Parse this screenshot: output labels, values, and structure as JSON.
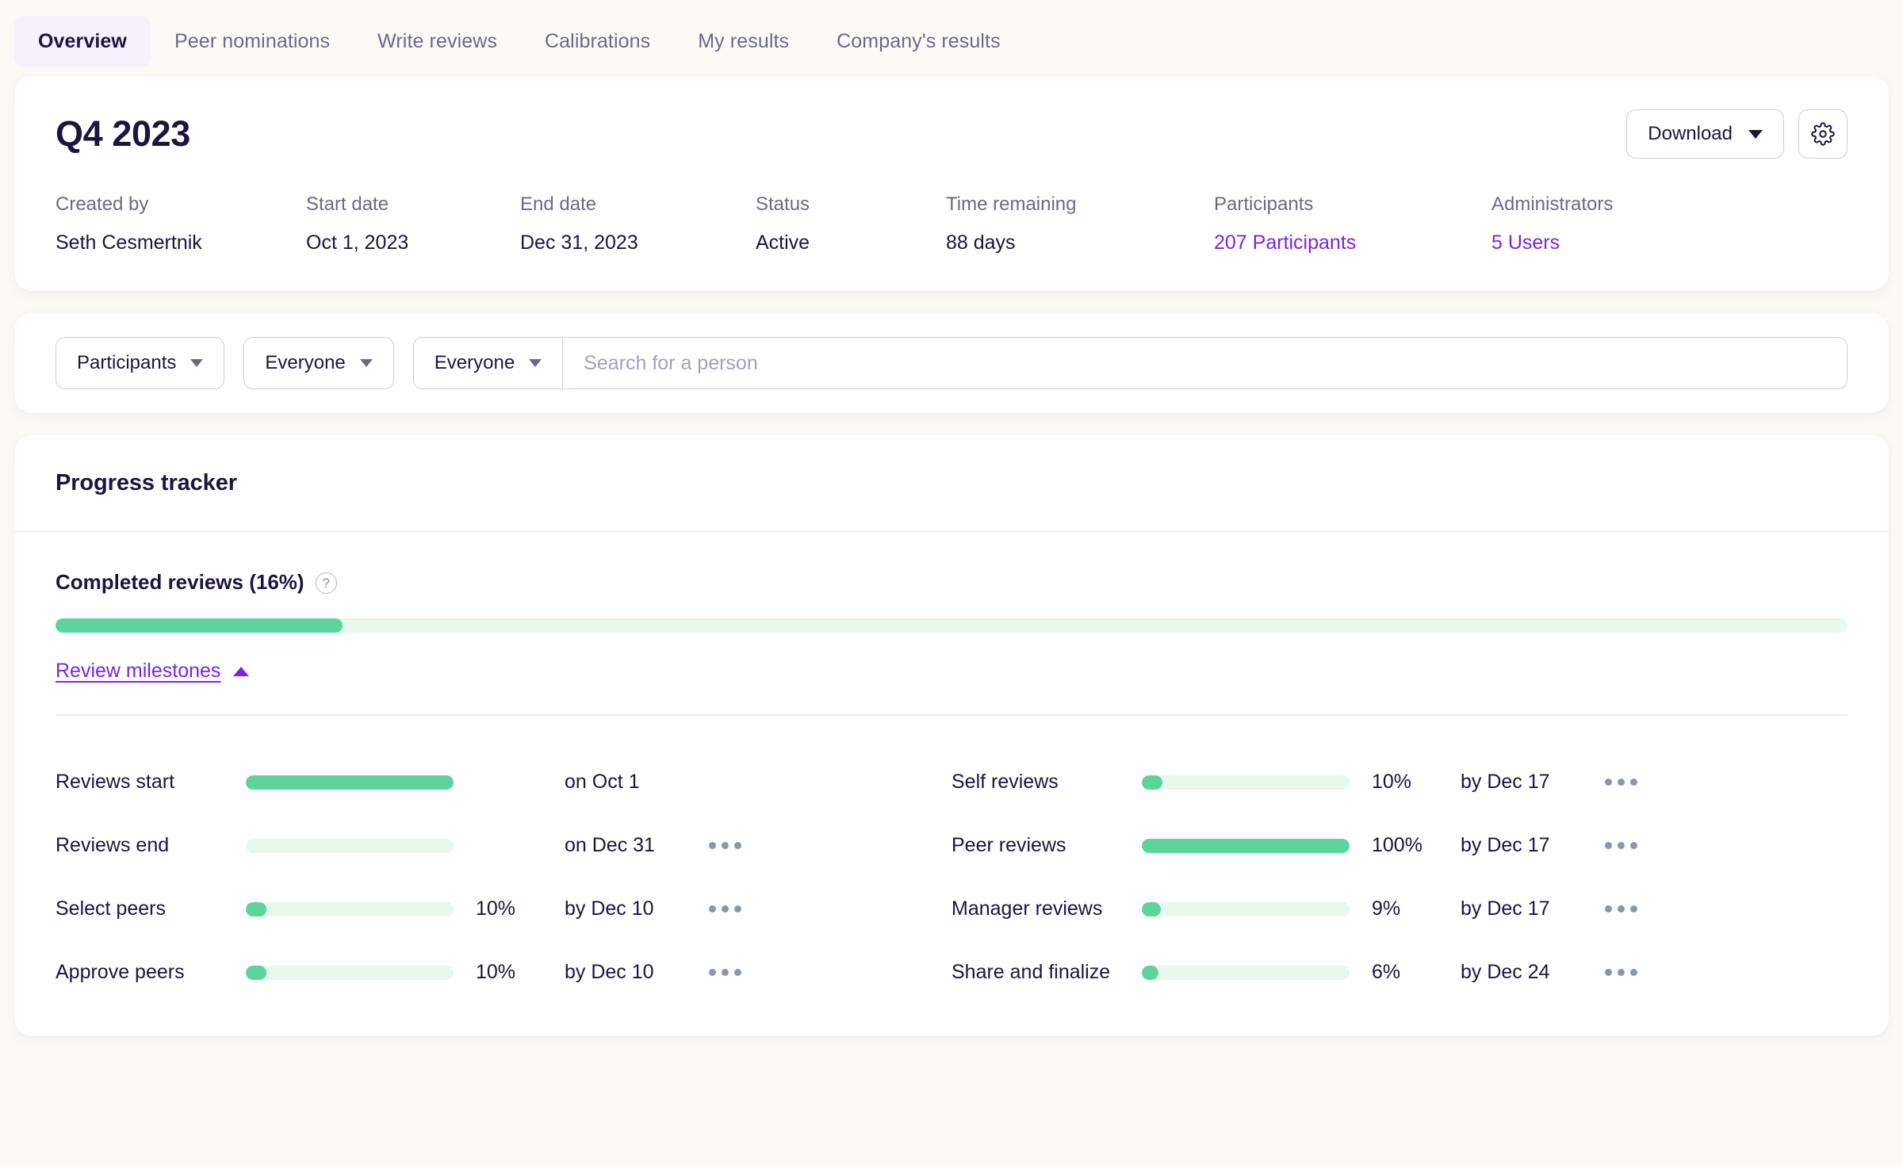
{
  "tabs": [
    {
      "label": "Overview",
      "active": true
    },
    {
      "label": "Peer nominations",
      "active": false
    },
    {
      "label": "Write reviews",
      "active": false
    },
    {
      "label": "Calibrations",
      "active": false
    },
    {
      "label": "My results",
      "active": false
    },
    {
      "label": "Company's results",
      "active": false
    }
  ],
  "header": {
    "title": "Q4 2023",
    "download_label": "Download",
    "settings_icon": "gear-icon",
    "meta": [
      {
        "label": "Created by",
        "value": "Seth Cesmertnik",
        "link": false
      },
      {
        "label": "Start date",
        "value": "Oct 1, 2023",
        "link": false
      },
      {
        "label": "End date",
        "value": "Dec 31, 2023",
        "link": false
      },
      {
        "label": "Status",
        "value": "Active",
        "link": false
      },
      {
        "label": "Time remaining",
        "value": "88 days",
        "link": false
      },
      {
        "label": "Participants",
        "value": "207 Participants",
        "link": true
      },
      {
        "label": "Administrators",
        "value": "5 Users",
        "link": true
      }
    ]
  },
  "filters": {
    "scope_select": "Participants",
    "group_select": "Everyone",
    "person_select": "Everyone",
    "search_placeholder": "Search for a person",
    "search_value": ""
  },
  "progress": {
    "section_title": "Progress tracker",
    "completed_label": "Completed reviews (16%)",
    "completed_percent": 16,
    "help_icon": "question-mark-icon",
    "milestones_link": "Review milestones",
    "milestones_caret": "chevron-up-icon",
    "milestones_left": [
      {
        "name": "Reviews start",
        "percent": 100,
        "percent_label": "",
        "due": "on Oct 1",
        "menu": false
      },
      {
        "name": "Reviews end",
        "percent": 0,
        "percent_label": "",
        "due": "on Dec 31",
        "menu": true
      },
      {
        "name": "Select peers",
        "percent": 10,
        "percent_label": "10%",
        "due": "by Dec 10",
        "menu": true
      },
      {
        "name": "Approve peers",
        "percent": 10,
        "percent_label": "10%",
        "due": "by Dec 10",
        "menu": true
      }
    ],
    "milestones_right": [
      {
        "name": "Self reviews",
        "percent": 10,
        "percent_label": "10%",
        "due": "by Dec 17",
        "menu": true
      },
      {
        "name": "Peer reviews",
        "percent": 100,
        "percent_label": "100%",
        "due": "by Dec 17",
        "menu": true
      },
      {
        "name": "Manager reviews",
        "percent": 9,
        "percent_label": "9%",
        "due": "by Dec 17",
        "menu": true
      },
      {
        "name": "Share and finalize",
        "percent": 6,
        "percent_label": "6%",
        "due": "by Dec 24",
        "menu": true
      }
    ]
  },
  "colors": {
    "accent_purple": "#7B24E8",
    "progress_green": "#5DD39E",
    "progress_track": "#EAF7EF",
    "text_dark": "#1E1440",
    "text_muted": "#6B6A86",
    "page_bg": "#FCFAF7"
  }
}
